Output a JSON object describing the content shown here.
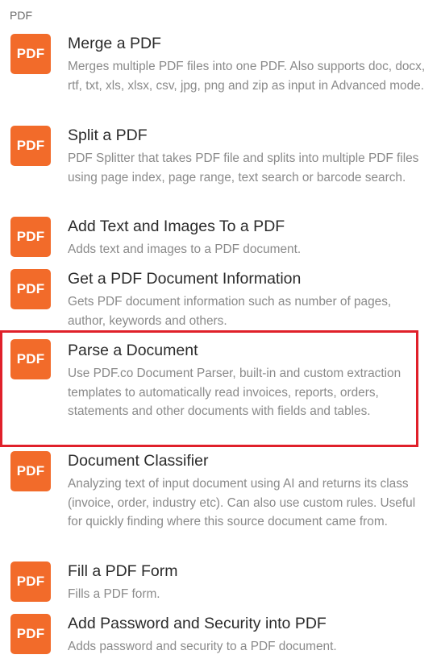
{
  "section": {
    "header": "PDF"
  },
  "items": [
    {
      "icon": "pdf-icon",
      "icon_label": "PDF",
      "title": "Merge a PDF",
      "description": "Merges multiple PDF files into one PDF. Also supports doc, docx, rtf, txt, xls, xlsx, csv, jpg, png and zip as input in Advanced mode."
    },
    {
      "icon": "pdf-icon",
      "icon_label": "PDF",
      "title": "Split a PDF",
      "description": "PDF Splitter that takes PDF file and splits into multiple PDF files using page index, page range, text search or barcode search."
    },
    {
      "icon": "pdf-icon",
      "icon_label": "PDF",
      "title": "Add Text and Images To a PDF",
      "description": "Adds text and images to a PDF document."
    },
    {
      "icon": "pdf-icon",
      "icon_label": "PDF",
      "title": "Get a PDF Document Information",
      "description": "Gets PDF document information such as number of pages, author, keywords and others."
    },
    {
      "icon": "pdf-icon",
      "icon_label": "PDF",
      "title": "Parse a Document",
      "description": "Use PDF.co Document Parser, built-in and custom extraction templates to automatically read invoices, reports, orders, statements and other documents with fields and tables."
    },
    {
      "icon": "pdf-icon",
      "icon_label": "PDF",
      "title": "Document Classifier",
      "description": "Analyzing text of input document using AI and returns its class (invoice, order, industry etc). Can also use custom rules. Useful for quickly finding where this source document came from."
    },
    {
      "icon": "pdf-icon",
      "icon_label": "PDF",
      "title": "Fill a PDF Form",
      "description": "Fills a PDF form."
    },
    {
      "icon": "pdf-icon",
      "icon_label": "PDF",
      "title": "Add Password and Security into PDF",
      "description": "Adds password and security to a PDF document."
    }
  ],
  "highlight_color": "#e0202a",
  "icon_color": "#f26b2a"
}
